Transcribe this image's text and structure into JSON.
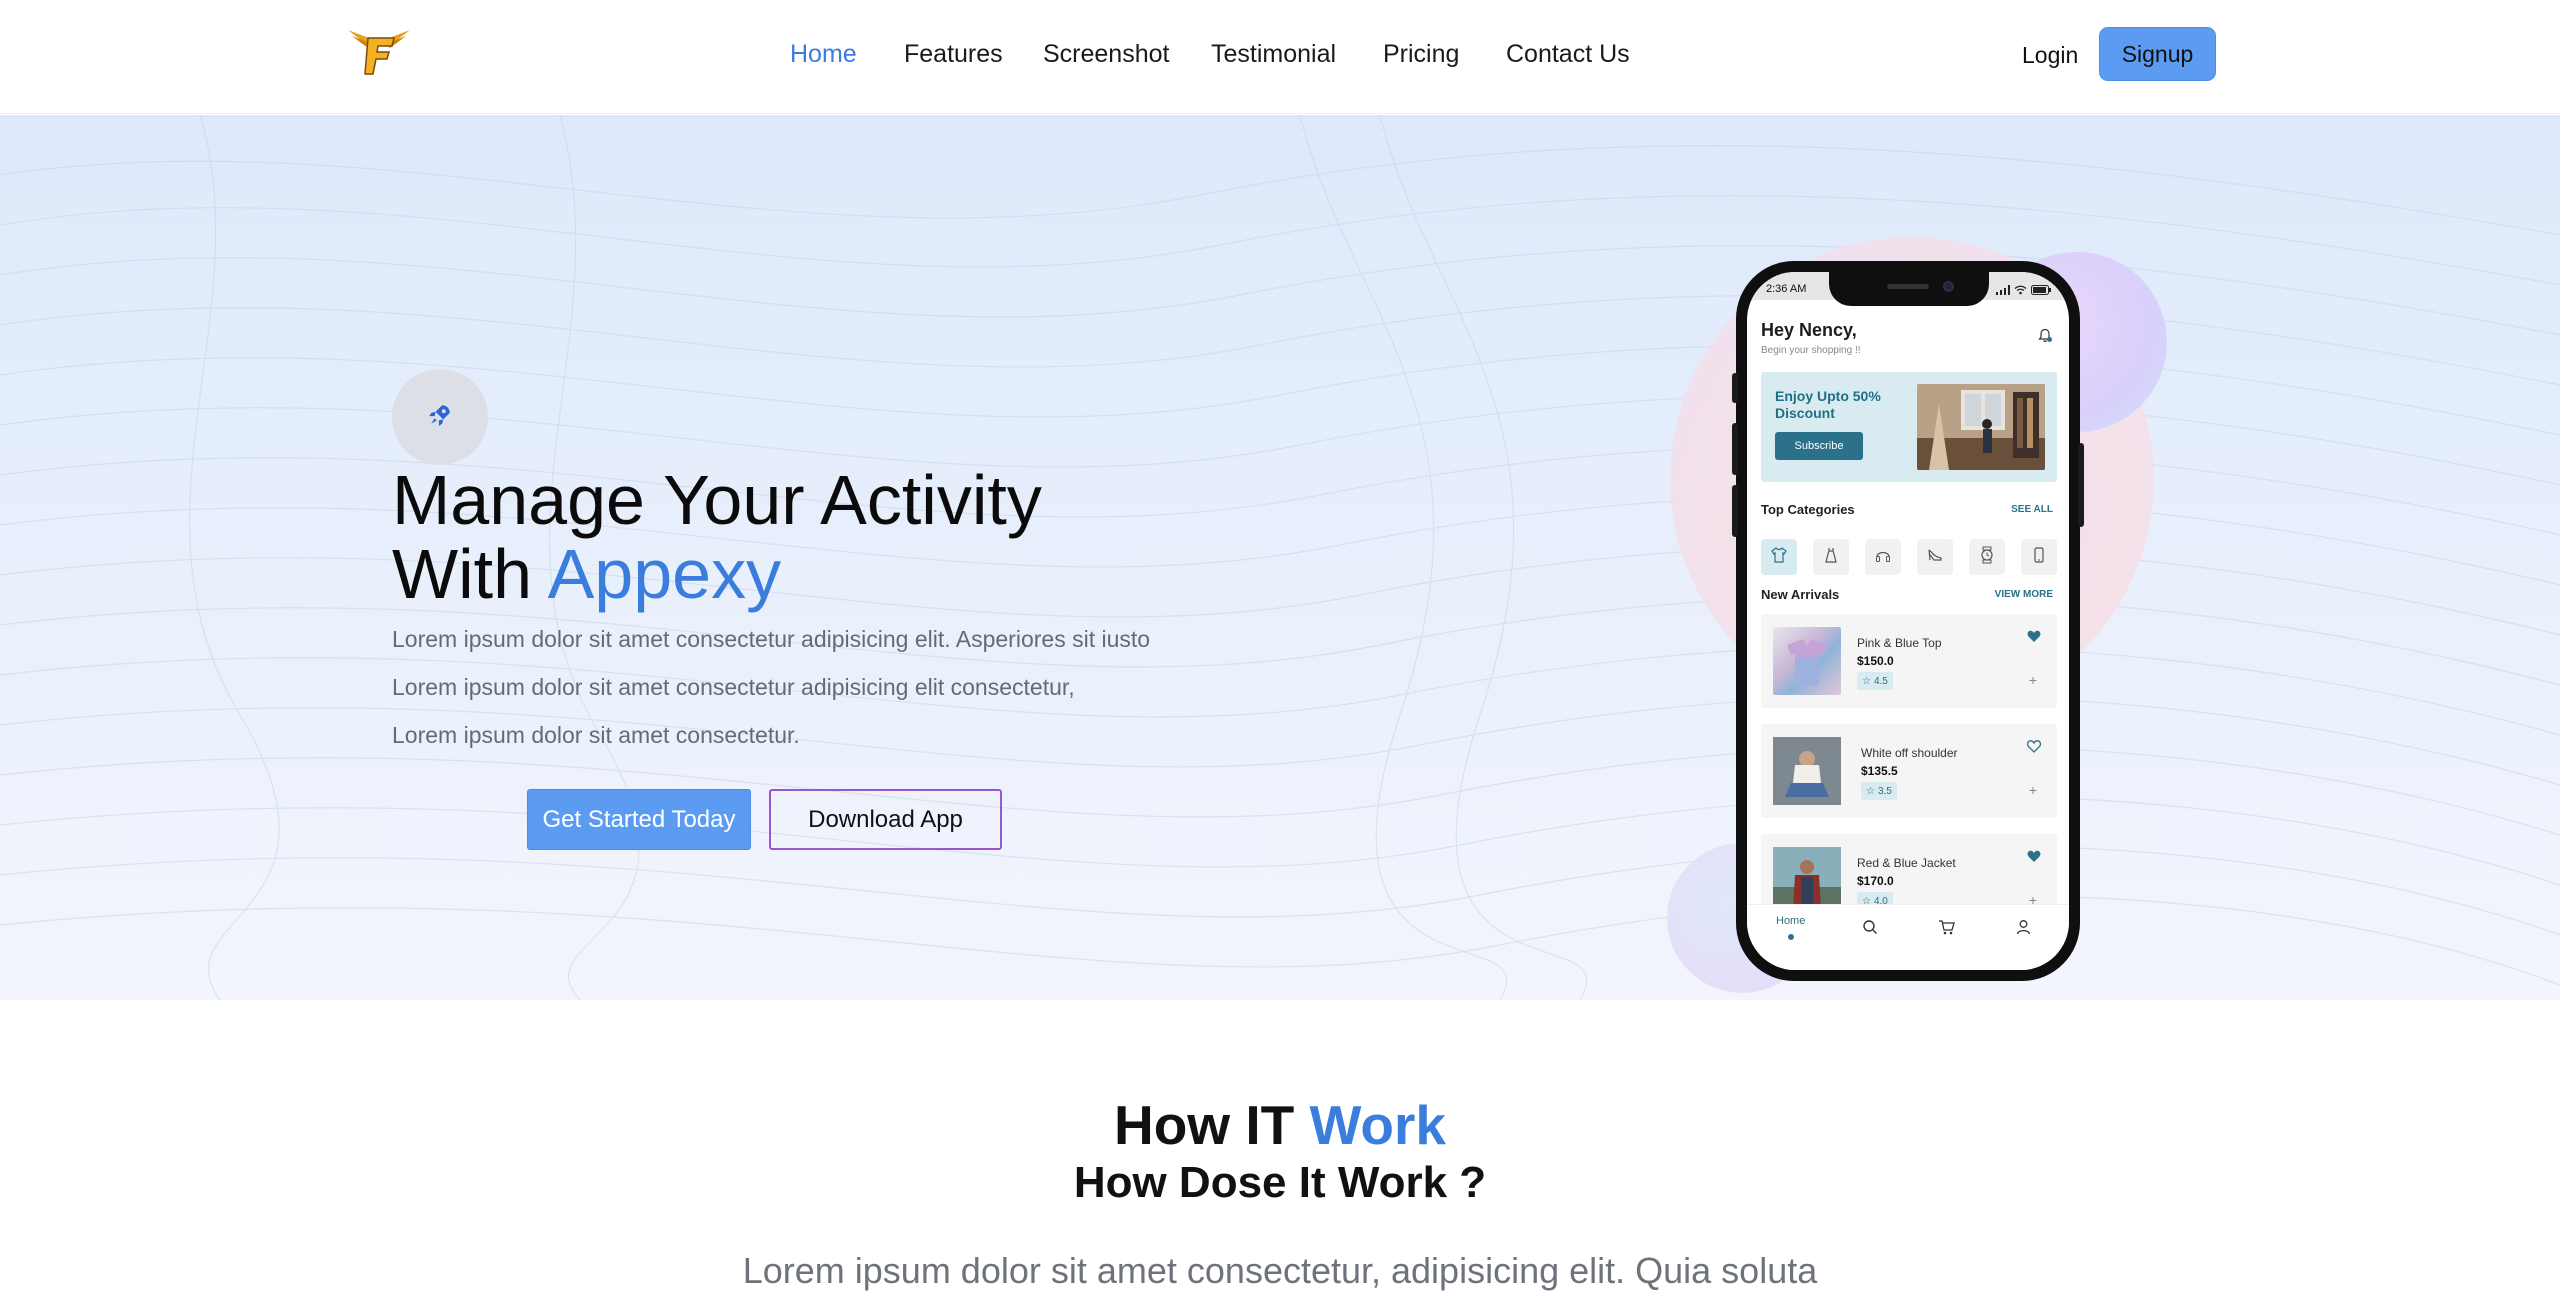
{
  "nav": {
    "links": [
      {
        "label": "Home",
        "active": true
      },
      {
        "label": "Features",
        "active": false
      },
      {
        "label": "Screenshot",
        "active": false
      },
      {
        "label": "Testimonial",
        "active": false
      },
      {
        "label": "Pricing",
        "active": false
      },
      {
        "label": "Contact Us",
        "active": false
      }
    ],
    "login": "Login",
    "signup": "Signup",
    "logo_icon": "winged-f-logo"
  },
  "hero": {
    "badge_icon": "rocket-icon",
    "title_line1": "Manage Your Activity",
    "title_line2_prefix": "With ",
    "title_line2_accent": "Appexy",
    "desc_lines": [
      "Lorem ipsum dolor sit amet consectetur adipisicing elit. Asperiores sit iusto",
      "Lorem ipsum dolor sit amet consectetur adipisicing elit consectetur,",
      "Lorem ipsum dolor sit amet consectetur."
    ],
    "primary_button": "Get Started Today",
    "secondary_button": "Download App"
  },
  "phone": {
    "status_time": "2:36 AM",
    "greeting": "Hey Nency,",
    "greeting_sub": "Begin your shopping !!",
    "promo_title": "Enjoy Upto 50% Discount",
    "promo_button": "Subscribe",
    "categories_label": "Top Categories",
    "categories_link": "SEE ALL",
    "categories": [
      "shirt-icon",
      "dress-icon",
      "headphones-icon",
      "heels-icon",
      "watch-icon",
      "phone-icon"
    ],
    "arrivals_label": "New Arrivals",
    "arrivals_link": "VIEW MORE",
    "products": [
      {
        "name": "Pink & Blue Top",
        "price": "$150.0",
        "rating": "4.5",
        "favorited": true
      },
      {
        "name": "White off shoulder",
        "price": "$135.5",
        "rating": "3.5",
        "favorited": false
      },
      {
        "name": "Red & Blue Jacket",
        "price": "$170.0",
        "rating": "4.0",
        "favorited": true
      }
    ],
    "bottom_nav": {
      "home": "Home",
      "icons": [
        "home-icon",
        "search-icon",
        "cart-icon",
        "profile-icon"
      ]
    }
  },
  "how": {
    "title_prefix": "How IT ",
    "title_accent": "Work",
    "subtitle": "How Dose It Work ?",
    "description": "Lorem ipsum dolor sit amet consectetur, adipisicing elit. Quia soluta"
  },
  "colors": {
    "accent": "#3b7ddd",
    "button_primary": "#5b9cf2",
    "outline_purple": "#9b55d4",
    "phone_teal": "#2a7189"
  }
}
